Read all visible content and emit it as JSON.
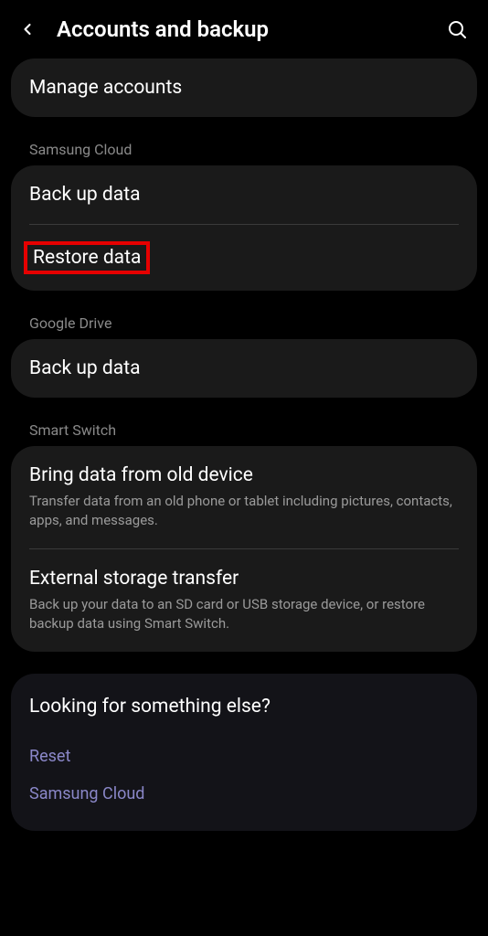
{
  "header": {
    "title": "Accounts and backup"
  },
  "sections": {
    "manage": {
      "label": "Manage accounts"
    },
    "samsung_cloud": {
      "header": "Samsung Cloud",
      "backup": "Back up data",
      "restore": "Restore data"
    },
    "google_drive": {
      "header": "Google Drive",
      "backup": "Back up data"
    },
    "smart_switch": {
      "header": "Smart Switch",
      "bring_title": "Bring data from old device",
      "bring_sub": "Transfer data from an old phone or tablet including pictures, contacts, apps, and messages.",
      "external_title": "External storage transfer",
      "external_sub": "Back up your data to an SD card or USB storage device, or restore backup data using Smart Switch."
    }
  },
  "footer": {
    "title": "Looking for something else?",
    "reset": "Reset",
    "samsung_cloud": "Samsung Cloud"
  }
}
